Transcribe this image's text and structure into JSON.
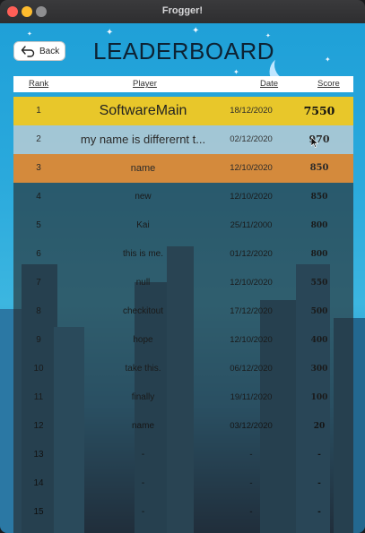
{
  "window": {
    "title": "Frogger!"
  },
  "back_button": {
    "label": "Back"
  },
  "heading": "LEADERBOARD",
  "columns": {
    "rank": "Rank",
    "player": "Player",
    "date": "Date",
    "score": "Score"
  },
  "rows": [
    {
      "rank": "1",
      "player": "SoftwareMain",
      "date": "18/12/2020",
      "score": "7550"
    },
    {
      "rank": "2",
      "player": "my name is differernt t...",
      "date": "02/12/2020",
      "score": "970"
    },
    {
      "rank": "3",
      "player": "name",
      "date": "12/10/2020",
      "score": "850"
    },
    {
      "rank": "4",
      "player": "new",
      "date": "12/10/2020",
      "score": "850"
    },
    {
      "rank": "5",
      "player": "Kai",
      "date": "25/11/2000",
      "score": "800"
    },
    {
      "rank": "6",
      "player": "this is me.",
      "date": "01/12/2020",
      "score": "800"
    },
    {
      "rank": "7",
      "player": "null",
      "date": "12/10/2020",
      "score": "550"
    },
    {
      "rank": "8",
      "player": "checkitout",
      "date": "17/12/2020",
      "score": "500"
    },
    {
      "rank": "9",
      "player": "hope",
      "date": "12/10/2020",
      "score": "400"
    },
    {
      "rank": "10",
      "player": "take this.",
      "date": "06/12/2020",
      "score": "300"
    },
    {
      "rank": "11",
      "player": "finally",
      "date": "19/11/2020",
      "score": "100"
    },
    {
      "rank": "12",
      "player": "name",
      "date": "03/12/2020",
      "score": "20"
    },
    {
      "rank": "13",
      "player": "-",
      "date": "-",
      "score": "-"
    },
    {
      "rank": "14",
      "player": "-",
      "date": "-",
      "score": "-"
    },
    {
      "rank": "15",
      "player": "-",
      "date": "-",
      "score": "-"
    }
  ],
  "colors": {
    "first_place": "#e8c72a",
    "second_place": "#d2d2d2",
    "third_place": "#d48a3c",
    "sky": "#2aa9dc"
  }
}
